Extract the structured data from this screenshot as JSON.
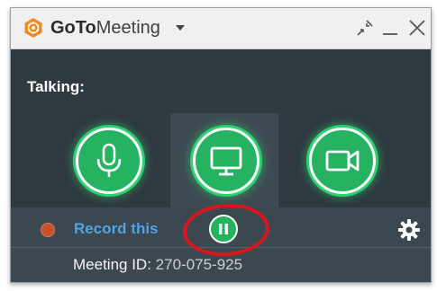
{
  "window": {
    "title_bold": "GoTo",
    "title_light": "Meeting",
    "controls": [
      "collapse",
      "minimize",
      "close"
    ]
  },
  "status": {
    "talking_label": "Talking:"
  },
  "controls": {
    "microphone": "mic-icon",
    "screen_share": "screen-icon",
    "camera": "camera-icon"
  },
  "recording": {
    "record_label": "Record this",
    "pause_icon": "pause-icon"
  },
  "meeting": {
    "id_label": "Meeting ID:",
    "id_value": "270-075-925"
  },
  "colors": {
    "accent_green": "#25b361",
    "link_blue": "#4fa3e6",
    "record_red": "#c9512f",
    "annotation_red": "#d9161b"
  }
}
